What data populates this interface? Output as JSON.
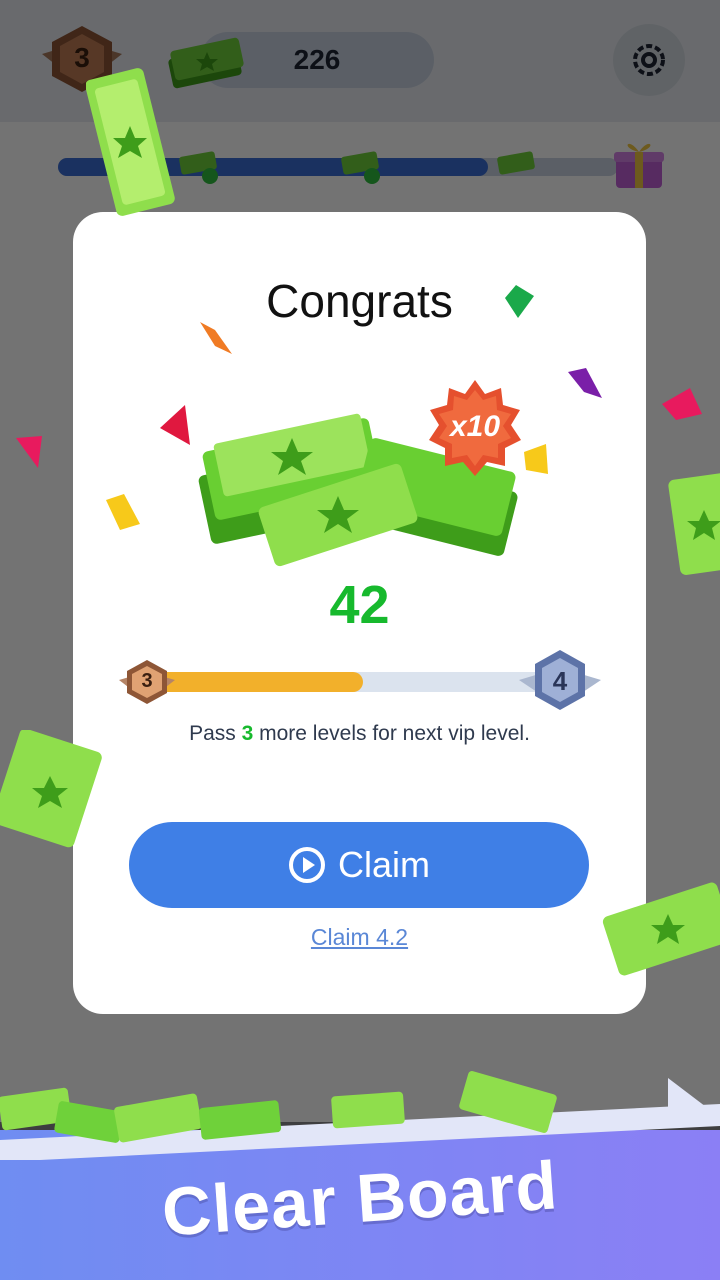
{
  "hud": {
    "vip_level": "3",
    "cash_amount": "226",
    "settings_icon": "gear-icon"
  },
  "modal": {
    "title": "Congrats",
    "multiplier": "x10",
    "reward_amount": "42",
    "progress": {
      "current_level": "3",
      "next_level": "4",
      "fill_fraction": 0.5
    },
    "hint_before": "Pass ",
    "hint_number": "3",
    "hint_after": " more levels for next vip level.",
    "claim_label": "Claim",
    "claim_icon": "play-circle-icon",
    "alt_claim_label": "Claim 4.2"
  },
  "footer": {
    "caption": "Clear Board"
  },
  "colors": {
    "accent_blue": "#3f7fe6",
    "reward_green": "#17b92d",
    "progress_orange": "#f2b02b"
  }
}
